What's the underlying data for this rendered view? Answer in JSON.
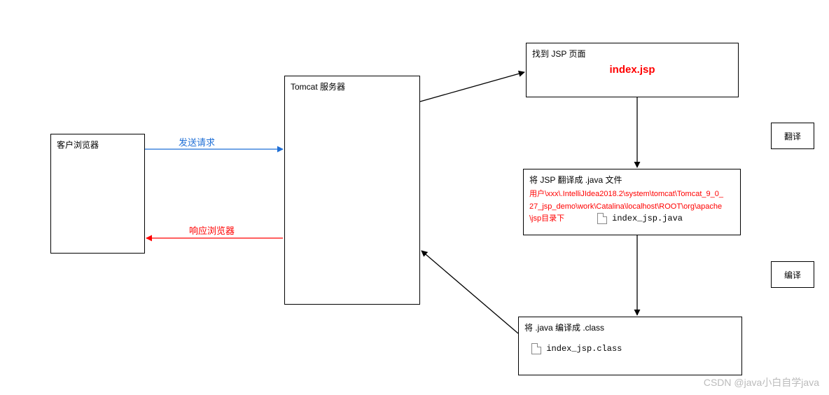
{
  "boxes": {
    "client": {
      "label": "客户浏览器"
    },
    "tomcat": {
      "label": "Tomcat 服务器"
    },
    "find_jsp": {
      "label": "找到 JSP 页面",
      "filename": "index.jsp"
    },
    "translate": {
      "label": "将 JSP 翻译成    .java 文件",
      "path_line1": "用户\\xxx\\.IntelliJIdea2018.2\\system\\tomcat\\Tomcat_9_0_",
      "path_line2": "27_jsp_demo\\work\\Catalina\\localhost\\ROOT\\org\\apache",
      "path_line3": "\\jsp目录下",
      "filename": "index_jsp.java"
    },
    "compile": {
      "label": "将   .java 编译成 .class",
      "filename": "index_jsp.class"
    }
  },
  "arrows": {
    "request_label": "发送请求",
    "response_label": "响应浏览器",
    "translate_label": "翻译",
    "compile_label": "编译"
  },
  "watermark": "CSDN @java小白自学java"
}
